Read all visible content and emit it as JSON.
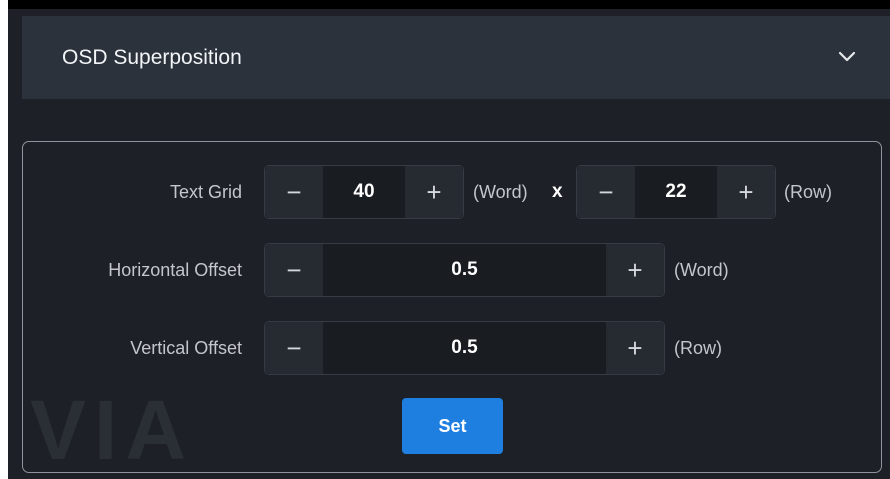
{
  "section": {
    "title": "OSD Superposition",
    "icon": "chevron-down-icon"
  },
  "form": {
    "text_grid": {
      "label": "Text Grid",
      "words": {
        "minus": "−",
        "value": "40",
        "plus": "+"
      },
      "word_unit": "(Word)",
      "times": "x",
      "rows": {
        "minus": "−",
        "value": "22",
        "plus": "+"
      },
      "row_unit": "(Row)"
    },
    "horizontal_offset": {
      "label": "Horizontal Offset",
      "minus": "−",
      "value": "0.5",
      "plus": "+",
      "unit": "(Word)"
    },
    "vertical_offset": {
      "label": "Vertical Offset",
      "minus": "−",
      "value": "0.5",
      "plus": "+",
      "unit": "(Row)"
    },
    "set_label": "Set"
  },
  "watermark": "VIA",
  "colors": {
    "background": "#1d2026",
    "header": "#2c323c",
    "accent": "#1f7fe0"
  }
}
